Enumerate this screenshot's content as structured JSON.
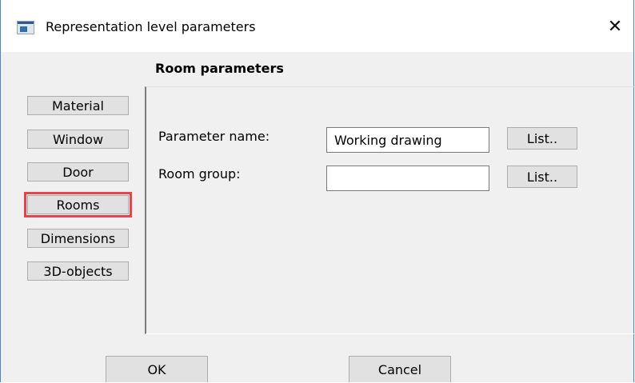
{
  "window": {
    "title": "Representation level parameters",
    "close_label": "✕",
    "app_icon": "window-app-icon"
  },
  "section": {
    "title": "Room parameters"
  },
  "sidebar": {
    "items": [
      {
        "label": "Material",
        "selected": false
      },
      {
        "label": "Window",
        "selected": false
      },
      {
        "label": "Door",
        "selected": false
      },
      {
        "label": "Rooms",
        "selected": true
      },
      {
        "label": "Dimensions",
        "selected": false
      },
      {
        "label": "3D-objects",
        "selected": false
      }
    ],
    "highlight_color": "#e8434a"
  },
  "params": {
    "parameter_name": {
      "label": "Parameter name:",
      "value": "Working drawing",
      "list_label": "List.."
    },
    "room_group": {
      "label": "Room group:",
      "value": "",
      "list_label": "List.."
    }
  },
  "footer": {
    "ok_label": "OK",
    "cancel_label": "Cancel"
  }
}
